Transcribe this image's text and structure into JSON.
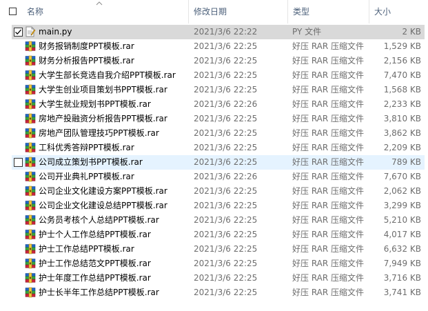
{
  "header": {
    "col_name": "名称",
    "col_date": "修改日期",
    "col_type": "类型",
    "col_size": "大小",
    "sort_indicator": "chevron-up-icon"
  },
  "files": [
    {
      "name": "main.py",
      "date": "2021/3/6 22:22",
      "type": "PY 文件",
      "size": "2 KB",
      "icon": "python-file-icon",
      "state": "selected",
      "checked": true
    },
    {
      "name": "财务报销制度PPT模板.rar",
      "date": "2021/3/6 22:25",
      "type": "好压 RAR 压缩文件",
      "size": "1,529 KB",
      "icon": "rar-archive-icon"
    },
    {
      "name": "财务分析报告PPT模板.rar",
      "date": "2021/3/6 22:25",
      "type": "好压 RAR 压缩文件",
      "size": "2,156 KB",
      "icon": "rar-archive-icon"
    },
    {
      "name": "大学生部长竞选自我介绍PPT模板.rar",
      "date": "2021/3/6 22:25",
      "type": "好压 RAR 压缩文件",
      "size": "7,470 KB",
      "icon": "rar-archive-icon"
    },
    {
      "name": "大学生创业项目策划书PPT模板.rar",
      "date": "2021/3/6 22:25",
      "type": "好压 RAR 压缩文件",
      "size": "1,568 KB",
      "icon": "rar-archive-icon"
    },
    {
      "name": "大学生就业规划书PPT模板.rar",
      "date": "2021/3/6 22:26",
      "type": "好压 RAR 压缩文件",
      "size": "2,233 KB",
      "icon": "rar-archive-icon"
    },
    {
      "name": "房地产投融资分析报告PPT模板.rar",
      "date": "2021/3/6 22:25",
      "type": "好压 RAR 压缩文件",
      "size": "3,810 KB",
      "icon": "rar-archive-icon"
    },
    {
      "name": "房地产团队管理技巧PPT模板.rar",
      "date": "2021/3/6 22:25",
      "type": "好压 RAR 压缩文件",
      "size": "3,862 KB",
      "icon": "rar-archive-icon"
    },
    {
      "name": "工科优秀答辩PPT模板.rar",
      "date": "2021/3/6 22:25",
      "type": "好压 RAR 压缩文件",
      "size": "2,209 KB",
      "icon": "rar-archive-icon"
    },
    {
      "name": "公司成立策划书PPT模板.rar",
      "date": "2021/3/6 22:25",
      "type": "好压 RAR 压缩文件",
      "size": "789 KB",
      "icon": "rar-archive-icon",
      "state": "hover",
      "checked": false
    },
    {
      "name": "公司开业典礼PPT模板.rar",
      "date": "2021/3/6 22:26",
      "type": "好压 RAR 压缩文件",
      "size": "7,670 KB",
      "icon": "rar-archive-icon"
    },
    {
      "name": "公司企业文化建设方案PPT模板.rar",
      "date": "2021/3/6 22:25",
      "type": "好压 RAR 压缩文件",
      "size": "2,062 KB",
      "icon": "rar-archive-icon"
    },
    {
      "name": "公司企业文化建设总结PPT模板.rar",
      "date": "2021/3/6 22:25",
      "type": "好压 RAR 压缩文件",
      "size": "3,299 KB",
      "icon": "rar-archive-icon"
    },
    {
      "name": "公务员考核个人总结PPT模板.rar",
      "date": "2021/3/6 22:25",
      "type": "好压 RAR 压缩文件",
      "size": "5,210 KB",
      "icon": "rar-archive-icon"
    },
    {
      "name": "护士个人工作总结PPT模板.rar",
      "date": "2021/3/6 22:25",
      "type": "好压 RAR 压缩文件",
      "size": "4,017 KB",
      "icon": "rar-archive-icon"
    },
    {
      "name": "护士工作总结PPT模板.rar",
      "date": "2021/3/6 22:25",
      "type": "好压 RAR 压缩文件",
      "size": "6,632 KB",
      "icon": "rar-archive-icon"
    },
    {
      "name": "护士工作总结范文PPT模板.rar",
      "date": "2021/3/6 22:25",
      "type": "好压 RAR 压缩文件",
      "size": "7,949 KB",
      "icon": "rar-archive-icon"
    },
    {
      "name": "护士年度工作总结PPT模板.rar",
      "date": "2021/3/6 22:25",
      "type": "好压 RAR 压缩文件",
      "size": "3,716 KB",
      "icon": "rar-archive-icon"
    },
    {
      "name": "护士长半年工作总结PPT模板.rar",
      "date": "2021/3/6 22:25",
      "type": "好压 RAR 压缩文件",
      "size": "3,741 KB",
      "icon": "rar-archive-icon"
    }
  ]
}
